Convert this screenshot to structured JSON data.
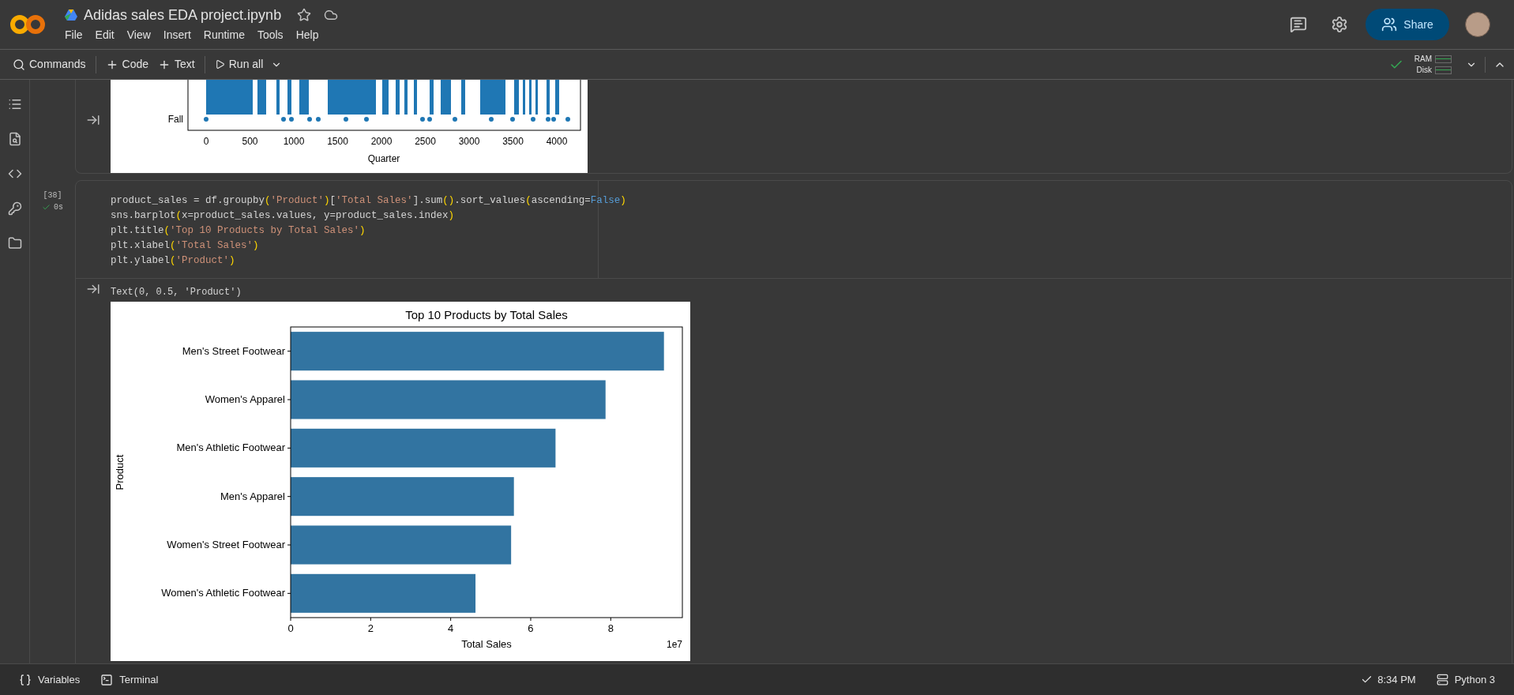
{
  "document": {
    "title": "Adidas sales EDA project.ipynb"
  },
  "menu": [
    "File",
    "Edit",
    "View",
    "Insert",
    "Runtime",
    "Tools",
    "Help"
  ],
  "share": {
    "label": "Share"
  },
  "toolbar": {
    "items": [
      {
        "kind": "search",
        "label": "Commands"
      },
      {
        "kind": "add",
        "label": "Code"
      },
      {
        "kind": "add",
        "label": "Text"
      },
      {
        "kind": "run",
        "label": "Run all"
      }
    ],
    "connected": true,
    "resources": [
      "RAM",
      "Disk"
    ]
  },
  "cells": [
    {
      "kind": "output",
      "chart_picture": {
        "category_label": "Fall",
        "xtick_labels": [
          "0",
          "500",
          "1000",
          "1500",
          "2000",
          "2500",
          "3000",
          "3500",
          "4000"
        ],
        "xlabel": "Quarter"
      }
    },
    {
      "kind": "code",
      "exec_count": "[38]",
      "duration": "0s",
      "succeeded": true,
      "code_lines": [
        [
          {
            "kind": "plain",
            "t": "product_sales = df.groupby"
          },
          {
            "kind": "paren",
            "t": "("
          },
          {
            "kind": "string",
            "t": "'Product'"
          },
          {
            "kind": "paren",
            "t": ")"
          },
          {
            "kind": "plain",
            "t": "["
          },
          {
            "kind": "string",
            "t": "'Total Sales'"
          },
          {
            "kind": "plain",
            "t": "].sum"
          },
          {
            "kind": "paren",
            "t": "()"
          },
          {
            "kind": "plain",
            "t": ".sort_values"
          },
          {
            "kind": "paren",
            "t": "("
          },
          {
            "kind": "plain",
            "t": "ascending="
          },
          {
            "kind": "keyword",
            "t": "False"
          },
          {
            "kind": "paren",
            "t": ")"
          }
        ],
        [
          {
            "kind": "plain",
            "t": "sns.barplot"
          },
          {
            "kind": "paren",
            "t": "("
          },
          {
            "kind": "plain",
            "t": "x=product_sales.values, y=product_sales.index"
          },
          {
            "kind": "paren",
            "t": ")"
          }
        ],
        [
          {
            "kind": "plain",
            "t": "plt.title"
          },
          {
            "kind": "paren",
            "t": "("
          },
          {
            "kind": "string",
            "t": "'Top 10 Products by Total Sales'"
          },
          {
            "kind": "paren",
            "t": ")"
          }
        ],
        [
          {
            "kind": "plain",
            "t": "plt.xlabel"
          },
          {
            "kind": "paren",
            "t": "("
          },
          {
            "kind": "string",
            "t": "'Total Sales'"
          },
          {
            "kind": "paren",
            "t": ")"
          }
        ],
        [
          {
            "kind": "plain",
            "t": "plt.ylabel"
          },
          {
            "kind": "paren",
            "t": "("
          },
          {
            "kind": "string",
            "t": "'Product'"
          },
          {
            "kind": "paren",
            "t": ")"
          }
        ]
      ],
      "output_text": "Text(0, 0.5, 'Product')",
      "chart_data": {
        "type": "bar",
        "orientation": "horizontal",
        "title": "Top 10 Products by Total Sales",
        "xlabel": "Total Sales",
        "ylabel": "Product",
        "categories": [
          "Men's Street Footwear",
          "Women's Apparel",
          "Men's Athletic Footwear",
          "Men's Apparel",
          "Women's Street Footwear",
          "Women's Athletic Footwear"
        ],
        "values": [
          9.33,
          7.87,
          6.62,
          5.58,
          5.51,
          4.62
        ],
        "xlim": [
          0,
          9.79
        ],
        "xticks": [
          0,
          2,
          4,
          6,
          8
        ],
        "annotations": [
          "1e7"
        ]
      }
    }
  ],
  "status_bar": {
    "left": [
      {
        "kind": "variables",
        "label": "Variables"
      },
      {
        "kind": "terminal",
        "label": "Terminal"
      }
    ],
    "time": "8:34 PM",
    "runtime": "Python 3"
  }
}
